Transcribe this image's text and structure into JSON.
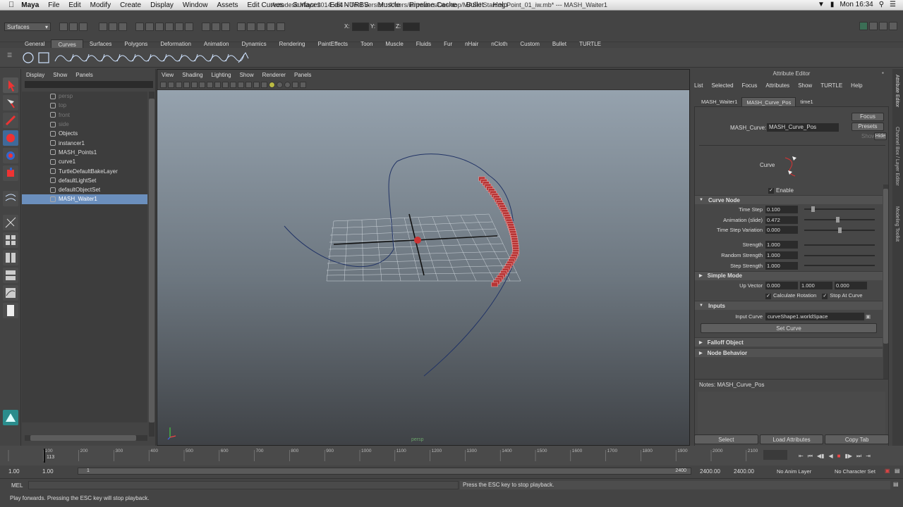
{
  "menubar": {
    "app": "Maya",
    "items": [
      "File",
      "Edit",
      "Modify",
      "Create",
      "Display",
      "Window",
      "Assets",
      "Edit Curves",
      "Surfaces",
      "Edit NURBS",
      "Muscle",
      "Pipeline Cache",
      "Bullet",
      "Help"
    ],
    "time": "Mon 16:34"
  },
  "window_title": "Autodesk Maya 2014 x64 – Trial Version: /Users/ianwaters/Desktop/MASH Starting Point_01_iw.mb*  ---  MASH_Waiter1",
  "status_line": {
    "menu_set": "Surfaces",
    "x_label": "X:",
    "y_label": "Y:",
    "z_label": "Z:"
  },
  "shelf": {
    "tabs": [
      "General",
      "Curves",
      "Surfaces",
      "Polygons",
      "Deformation",
      "Animation",
      "Dynamics",
      "Rendering",
      "PaintEffects",
      "Toon",
      "Muscle",
      "Fluids",
      "Fur",
      "nHair",
      "nCloth",
      "Custom",
      "Bullet",
      "TURTLE"
    ],
    "active": "Curves"
  },
  "outliner": {
    "menu": [
      "Display",
      "Show",
      "Panels"
    ],
    "items": [
      {
        "label": "persp",
        "dim": true
      },
      {
        "label": "top",
        "dim": true
      },
      {
        "label": "front",
        "dim": true
      },
      {
        "label": "side",
        "dim": true
      },
      {
        "label": "Objects",
        "dim": false
      },
      {
        "label": "instancer1",
        "dim": false
      },
      {
        "label": "MASH_Points1",
        "dim": false
      },
      {
        "label": "curve1",
        "dim": false
      },
      {
        "label": "TurtleDefaultBakeLayer",
        "dim": false
      },
      {
        "label": "defaultLightSet",
        "dim": false
      },
      {
        "label": "defaultObjectSet",
        "dim": false
      },
      {
        "label": "MASH_Waiter1",
        "dim": false,
        "selected": true
      }
    ]
  },
  "viewport": {
    "menu": [
      "View",
      "Shading",
      "Lighting",
      "Show",
      "Renderer",
      "Panels"
    ],
    "camera_label": "persp"
  },
  "attr_editor": {
    "title": "Attribute Editor",
    "menu": [
      "List",
      "Selected",
      "Focus",
      "Attributes",
      "Show",
      "TURTLE",
      "Help"
    ],
    "tabs": [
      "MASH_Waiter1",
      "MASH_Curve_Pos",
      "time1"
    ],
    "active_tab": "MASH_Curve_Pos",
    "node_label": "MASH_Curve:",
    "node_value": "MASH_Curve_Pos",
    "focus": "Focus",
    "presets": "Presets",
    "show": "Show",
    "hide": "Hide",
    "curve_label": "Curve",
    "enable": "Enable",
    "section_curve_node": "Curve Node",
    "fields": [
      {
        "label": "Time Step",
        "value": "0.100",
        "slider": 0.1
      },
      {
        "label": "Animation (slide)",
        "value": "0.472",
        "slider": 0.472
      },
      {
        "label": "Time Step Variation",
        "value": "0.000",
        "slider": 0.5
      }
    ],
    "fields2": [
      {
        "label": "Strength",
        "value": "1.000"
      },
      {
        "label": "Random Strength",
        "value": "1.000"
      },
      {
        "label": "Step Strength",
        "value": "1.000"
      }
    ],
    "simple_mode": "Simple Mode",
    "up_vector": {
      "label": "Up Vector",
      "x": "0.000",
      "y": "1.000",
      "z": "0.000"
    },
    "calc_rotation": "Calculate Rotation",
    "stop_at_curve": "Stop At Curve",
    "inputs": "Inputs",
    "input_curve_label": "Input Curve",
    "input_curve_value": "curveShape1.worldSpace",
    "set_curve": "Set Curve",
    "falloff": "Falloff Object",
    "node_behavior": "Node Behavior",
    "notes": "Notes:  MASH_Curve_Pos",
    "buttons": [
      "Select",
      "Load Attributes",
      "Copy Tab"
    ]
  },
  "side_tabs": [
    "Attribute Editor",
    "Channel Box / Layer Editor",
    "Modeling Toolkit"
  ],
  "timeline": {
    "ticks": [
      "100",
      "200",
      "300",
      "400",
      "500",
      "600",
      "700",
      "800",
      "900",
      "1000",
      "1100",
      "1200",
      "1300",
      "1400",
      "1500",
      "1600",
      "1700",
      "1800",
      "1900",
      "2000",
      "2100"
    ],
    "current": "113",
    "start": "1.00",
    "start2": "1.00",
    "range_start": "1",
    "range_end": "2400",
    "end": "2400.00",
    "end2": "2400.00",
    "anim_layer": "No Anim Layer",
    "char_set": "No Character Set"
  },
  "command": {
    "label": "MEL",
    "result": "Press the ESC key to stop playback."
  },
  "help_line": "Play forwards. Pressing the ESC key will stop playback."
}
